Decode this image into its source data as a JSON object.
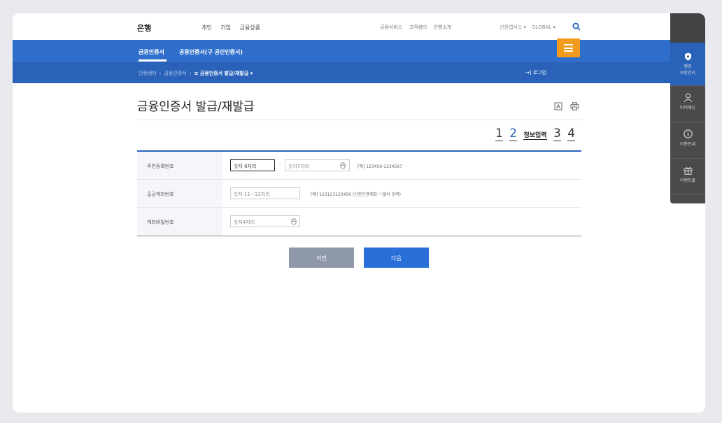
{
  "header": {
    "brand": "은행",
    "main_menu": [
      "개인",
      "기업",
      "금융상품"
    ],
    "util_menu": [
      "금융서비스",
      "고객센터",
      "은행소개"
    ],
    "lang_menu": [
      "신한앱서스 ▾",
      "GLOBAL ▾"
    ]
  },
  "nav": {
    "tab_main": "금융인증서",
    "tab_second": "공동인증서(구 공인인증서)"
  },
  "breadcrumb": {
    "items": [
      "인증센터",
      "금융인증서"
    ],
    "current": "≡ 금융인증서 발급/재발급 ▾",
    "login": "→] 로그인"
  },
  "sidebar": {
    "items": [
      "뱅킹\n보안관리",
      "마이메뉴",
      "이용안내",
      "이벤트몰"
    ]
  },
  "page": {
    "title": "금융인증서 발급/재발급"
  },
  "steps": {
    "s1": "1",
    "s2": "2",
    "s2_label": "정보입력",
    "s3": "3",
    "s4": "4"
  },
  "form": {
    "rows": [
      {
        "label": "주민등록번호",
        "input1": "숫자 6자리",
        "dash": "-",
        "input2": "숫자7자리",
        "hint": "[예] 123456-1234567"
      },
      {
        "label": "출금계좌번호",
        "input1": "숫자 11~12자리",
        "hint": "[예] 123123123456 (신한은행계좌 '-'없이 입력)"
      },
      {
        "label": "계좌비밀번호",
        "input1": "숫자4자리"
      }
    ]
  },
  "buttons": {
    "prev": "이전",
    "next": "다음"
  },
  "colors": {
    "primary": "#2f6fcb",
    "secondary_bar": "#2a62b9",
    "menu_button": "#f29a1c",
    "next_button": "#2a6fd8",
    "prev_button": "#8e98a8"
  }
}
